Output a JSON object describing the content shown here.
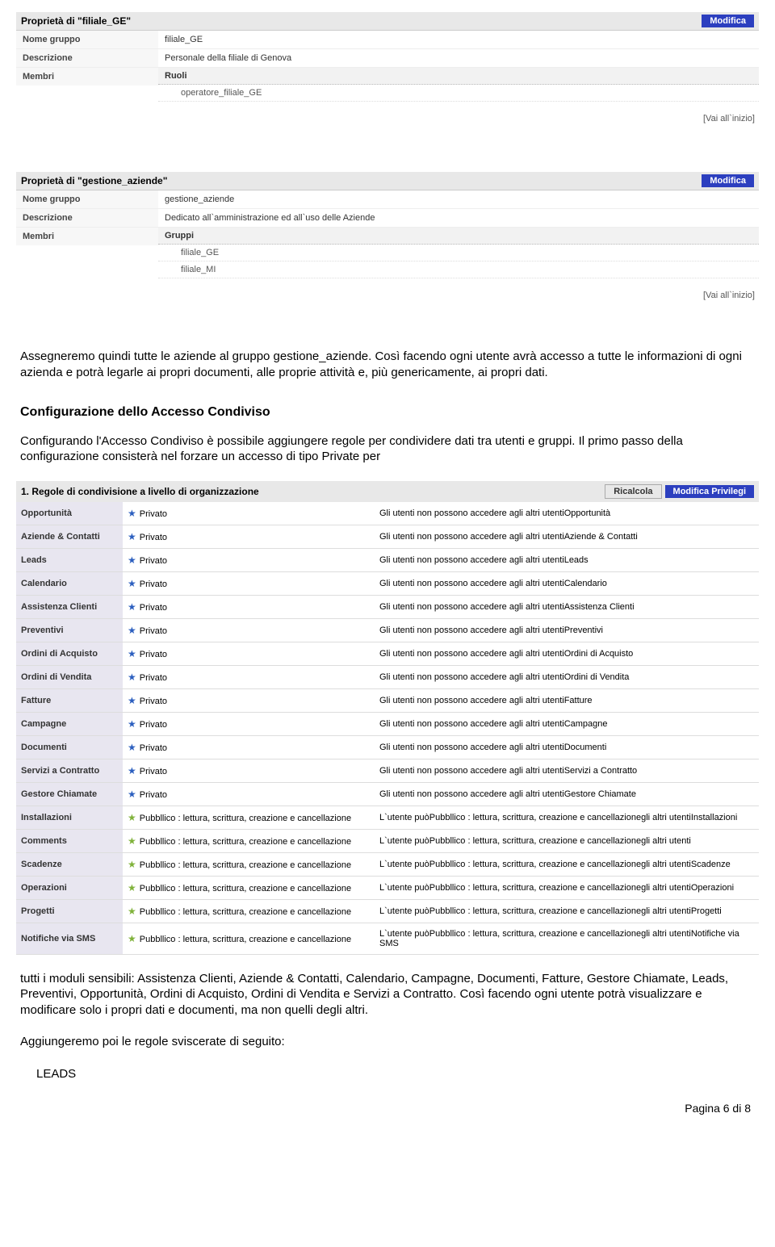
{
  "panel1": {
    "title": "Proprietà di \"filiale_GE\"",
    "modify": "Modifica",
    "rows": {
      "name_label": "Nome gruppo",
      "name_value": "filiale_GE",
      "desc_label": "Descrizione",
      "desc_value": "Personale della filiale di Genova",
      "members_label": "Membri"
    },
    "sub_header": "Ruoli",
    "sub_items": [
      "operatore_filiale_GE"
    ],
    "goto_top": "[Vai all`inizio]"
  },
  "panel2": {
    "title": "Proprietà di \"gestione_aziende\"",
    "modify": "Modifica",
    "rows": {
      "name_label": "Nome gruppo",
      "name_value": "gestione_aziende",
      "desc_label": "Descrizione",
      "desc_value": "Dedicato all`amministrazione ed all`uso delle Aziende",
      "members_label": "Membri"
    },
    "sub_header": "Gruppi",
    "sub_items": [
      "filiale_GE",
      "filiale_MI"
    ],
    "goto_top": "[Vai all`inizio]"
  },
  "body1": "Assegneremo quindi tutte le aziende al gruppo gestione_aziende. Così facendo ogni utente avrà accesso a tutte le informazioni di ogni azienda e potrà legarle ai propri documenti, alle proprie attività e, più genericamente, ai propri dati.",
  "body_h3": "Configurazione dello Accesso Condiviso",
  "body2": "Configurando l'Accesso Condiviso è possibile aggiungere regole per condividere dati tra utenti e gruppi. Il primo passo della configurazione consisterà nel forzare un accesso di tipo Private per",
  "rules": {
    "header": "1. Regole di condivisione a livello di organizzazione",
    "btn_recalc": "Ricalcola",
    "btn_modify": "Modifica Privilegi",
    "private_label": "Privato",
    "public_label": "Pubbllico : lettura, scrittura, creazione e cancellazione",
    "private_desc_prefix": "Gli utenti non possono accedere agli altri utenti",
    "public_desc_prefix": "L`utente puòPubbllico : lettura, scrittura, creazione e cancellazionegli altri utenti",
    "rows_private": [
      {
        "module": "Opportunità",
        "suffix": "Opportunità"
      },
      {
        "module": "Aziende & Contatti",
        "suffix": "Aziende & Contatti"
      },
      {
        "module": "Leads",
        "suffix": "Leads"
      },
      {
        "module": "Calendario",
        "suffix": "Calendario"
      },
      {
        "module": "Assistenza Clienti",
        "suffix": "Assistenza Clienti"
      },
      {
        "module": "Preventivi",
        "suffix": "Preventivi"
      },
      {
        "module": "Ordini di Acquisto",
        "suffix": "Ordini di Acquisto"
      },
      {
        "module": "Ordini di Vendita",
        "suffix": "Ordini di Vendita"
      },
      {
        "module": "Fatture",
        "suffix": "Fatture"
      },
      {
        "module": "Campagne",
        "suffix": "Campagne"
      },
      {
        "module": "Documenti",
        "suffix": "Documenti"
      },
      {
        "module": "Servizi a Contratto",
        "suffix": "Servizi a Contratto"
      },
      {
        "module": "Gestore Chiamate",
        "suffix": "Gestore Chiamate"
      }
    ],
    "rows_public": [
      {
        "module": "Installazioni",
        "suffix": "Installazioni"
      },
      {
        "module": "Comments",
        "suffix": ""
      },
      {
        "module": "Scadenze",
        "suffix": "Scadenze"
      },
      {
        "module": "Operazioni",
        "suffix": "Operazioni"
      },
      {
        "module": "Progetti",
        "suffix": "Progetti"
      },
      {
        "module": "Notifiche via SMS",
        "suffix": "Notifiche via SMS"
      }
    ]
  },
  "body3": "tutti i moduli sensibili: Assistenza Clienti, Aziende & Contatti, Calendario, Campagne, Documenti, Fatture, Gestore Chiamate, Leads, Preventivi, Opportunità, Ordini di Acquisto, Ordini di Vendita e Servizi a Contratto. Così facendo ogni utente potrà visualizzare e modificare solo i propri dati e documenti, ma non quelli degli altri.",
  "body4": "Aggiungeremo poi le regole sviscerate di seguito:",
  "body5": "LEADS",
  "footer": "Pagina 6 di 8"
}
